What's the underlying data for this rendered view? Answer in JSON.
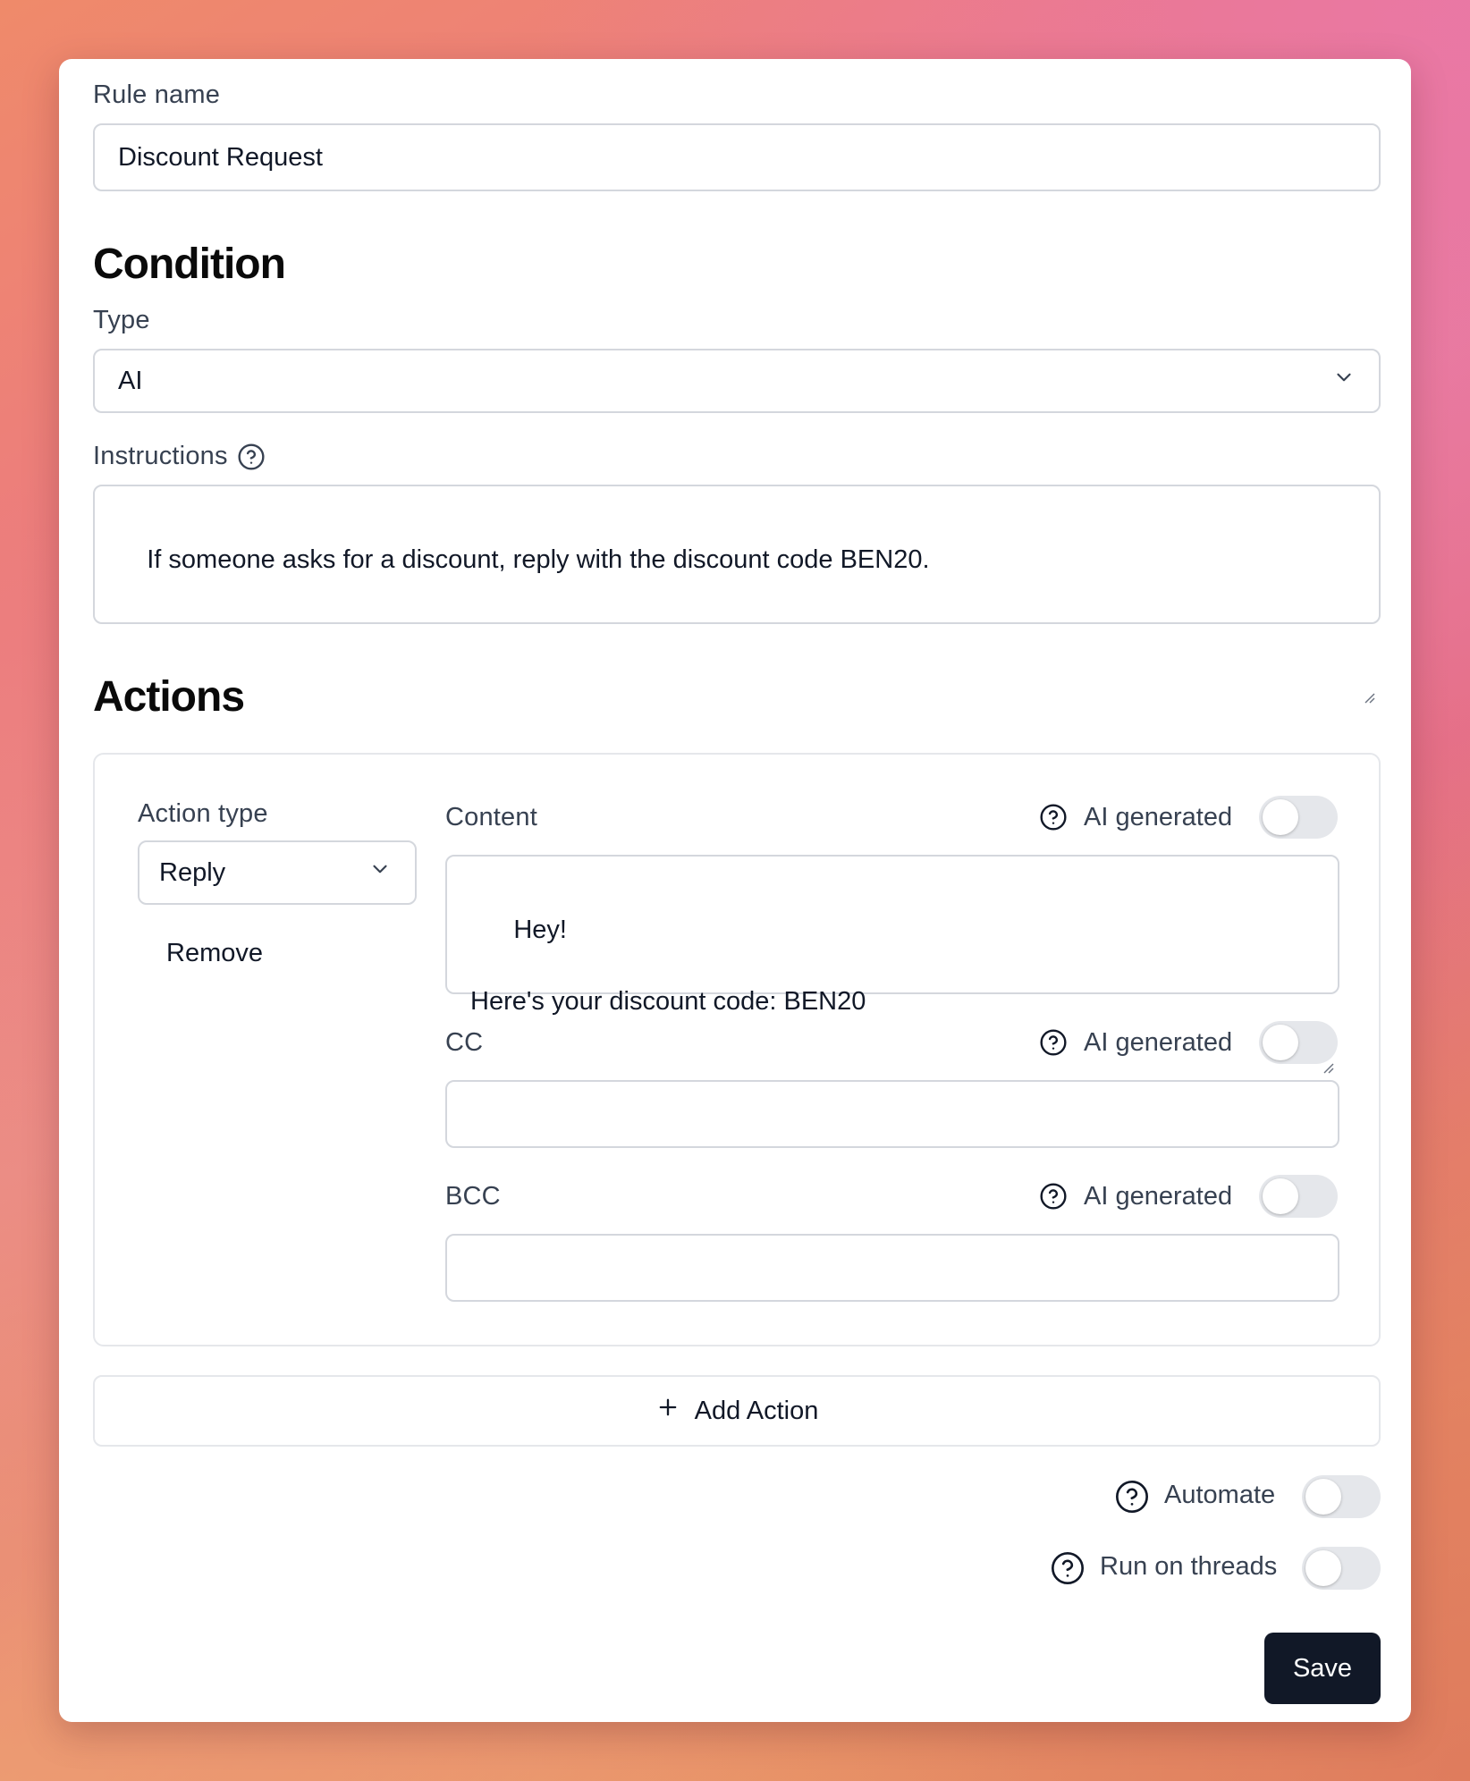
{
  "rule": {
    "name_label": "Rule name",
    "name_value": "Discount Request"
  },
  "condition": {
    "heading": "Condition",
    "type_label": "Type",
    "type_value": "AI",
    "instructions_label": "Instructions",
    "instructions_value": "If someone asks for a discount, reply with the discount code BEN20."
  },
  "actions": {
    "heading": "Actions",
    "items": [
      {
        "action_type_label": "Action type",
        "action_type_value": "Reply",
        "remove_label": "Remove",
        "content_label": "Content",
        "content_value": "Hey!\n\nHere's your discount code: BEN20",
        "content_ai_label": "AI generated",
        "content_ai_enabled": false,
        "cc_label": "CC",
        "cc_value": "",
        "cc_ai_label": "AI generated",
        "cc_ai_enabled": false,
        "bcc_label": "BCC",
        "bcc_value": "",
        "bcc_ai_label": "AI generated",
        "bcc_ai_enabled": false
      }
    ],
    "add_action_label": "Add Action"
  },
  "options": {
    "automate_label": "Automate",
    "automate_enabled": false,
    "run_on_threads_label": "Run on threads",
    "run_on_threads_enabled": false
  },
  "save_label": "Save",
  "icons": {
    "help": "help-circle-icon",
    "chevron": "chevron-down-icon",
    "plus": "plus-icon"
  },
  "colors": {
    "primary_button": "#111827",
    "toggle_off": "#e5e7eb",
    "border": "#d4d7dd"
  }
}
